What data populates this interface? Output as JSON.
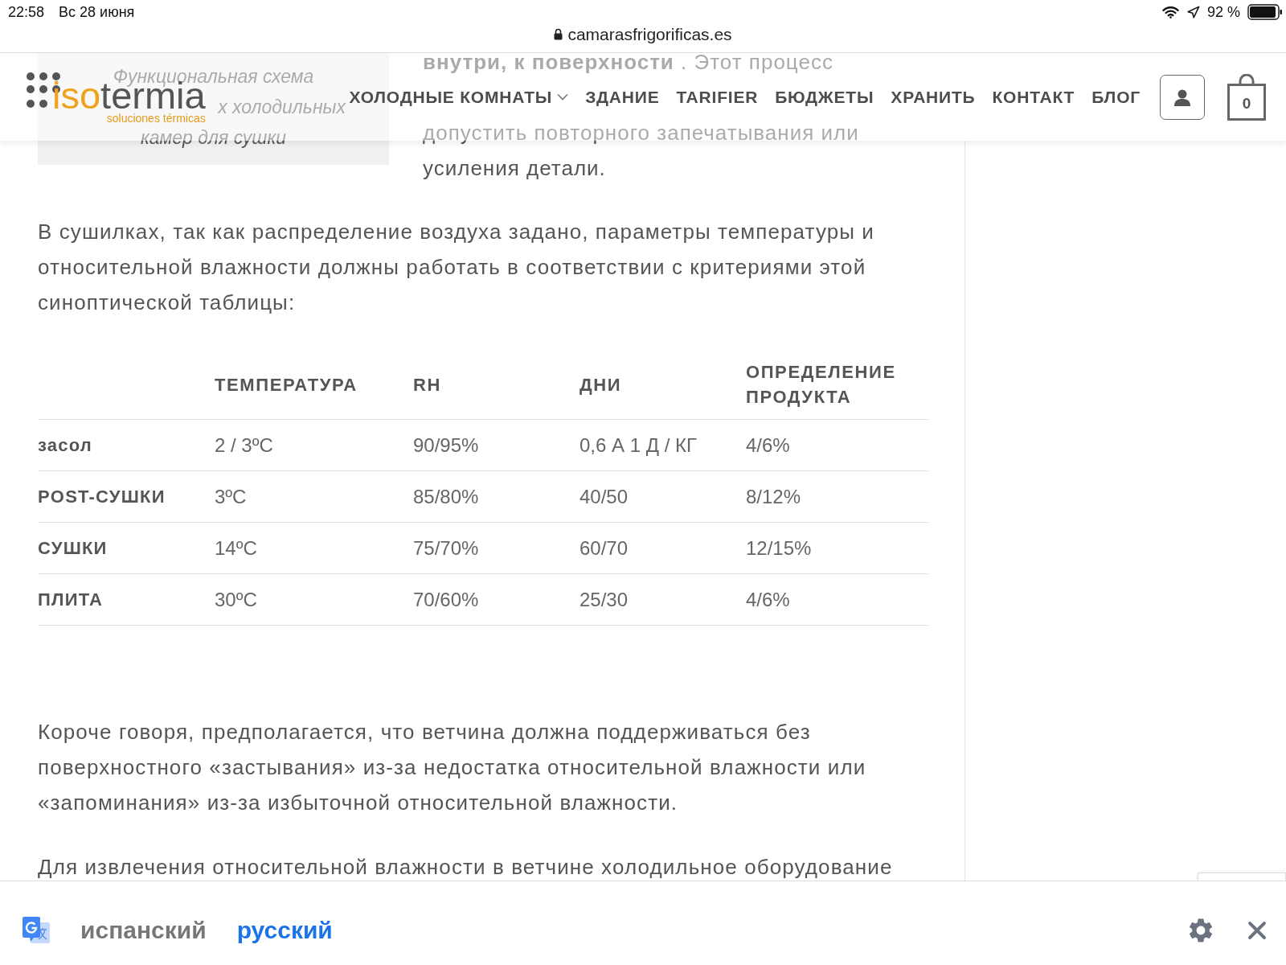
{
  "status_bar": {
    "time": "22:58",
    "date": "Вс 28 июня",
    "battery": "92 %"
  },
  "address_bar": {
    "url": "camarasfrigorificas.es"
  },
  "site_header": {
    "logo": {
      "word_start": "iso",
      "word_end": "termia",
      "tagline": "soluciones térmicas"
    },
    "nav": [
      {
        "label": "ХОЛОДНЫЕ КОМНАТЫ",
        "has_submenu": true
      },
      {
        "label": "ЗДАНИЕ",
        "has_submenu": false
      },
      {
        "label": "TARIFIER",
        "has_submenu": false
      },
      {
        "label": "БЮДЖЕТЫ",
        "has_submenu": false
      },
      {
        "label": "ХРАНИТЬ",
        "has_submenu": false
      },
      {
        "label": "КОНТАКТ",
        "has_submenu": false
      },
      {
        "label": "БЛОГ",
        "has_submenu": false
      }
    ],
    "cart_count": "0"
  },
  "article": {
    "figure_caption": [
      "Функциональная схема",
      "х холодильных",
      "камер для сушки"
    ],
    "side_text": [
      "**внутри, к поверхности** . Этот процесс",
      "допустить повторного запечатывания или",
      "усиления детали."
    ],
    "paragraphs_before_table": [
      "В сушилках, так как распределение воздуха задано, параметры температуры и относительной влажности должны работать в соответствии с критериями этой синоптической таблицы:"
    ],
    "table": {
      "columns": [
        "ТЕМПЕРАТУРА",
        "RH",
        "ДНИ",
        "ОПРЕДЕЛЕНИЕ ПРОДУКТА"
      ],
      "rows": [
        {
          "label": "засол",
          "cells": [
            "2 / 3ºC",
            "90/95%",
            "0,6 А 1 Д / КГ",
            "4/6%"
          ]
        },
        {
          "label": "POST-СУШКИ",
          "cells": [
            "3ºC",
            "85/80%",
            "40/50",
            "8/12%"
          ]
        },
        {
          "label": "СУШКИ",
          "cells": [
            "14ºC",
            "75/70%",
            "60/70",
            "12/15%"
          ]
        },
        {
          "label": "ПЛИТА",
          "cells": [
            "30ºC",
            "70/60%",
            "25/30",
            "4/6%"
          ]
        }
      ]
    },
    "paragraphs_after_table": [
      "Короче говоря, предполагается, что ветчина должна поддерживаться без поверхностного «застывания» из-за недостатка относительной влажности или «запоминания» из-за избыточной относительной влажности.",
      "Для извлечения относительной влажности в ветчине холодильное оборудование"
    ]
  },
  "translate_bar": {
    "languages": [
      {
        "label": "испанский",
        "selected": false
      },
      {
        "label": "русский",
        "selected": true
      }
    ]
  }
}
